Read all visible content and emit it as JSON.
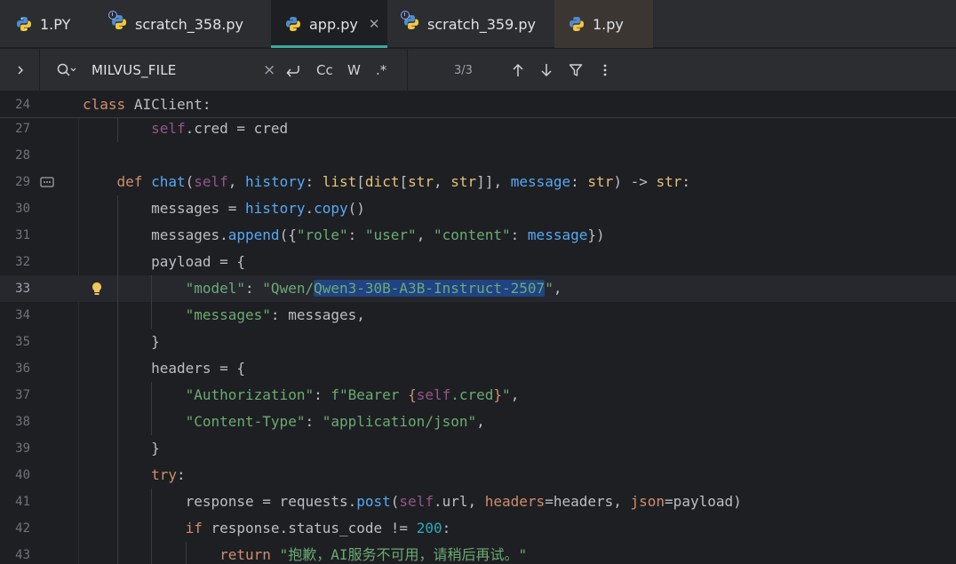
{
  "tabs": [
    {
      "label": "1.PY",
      "active": false,
      "badge": false
    },
    {
      "label": "scratch_358.py",
      "active": false,
      "badge": true
    },
    {
      "label": "app.py",
      "active": true,
      "badge": false
    },
    {
      "label": "scratch_359.py",
      "active": false,
      "badge": true
    },
    {
      "label": "1.py",
      "active": false,
      "badge": false
    }
  ],
  "search": {
    "query": "MILVUS_FILE",
    "clear": "×",
    "case_label": "Cc",
    "word_label": "W",
    "regex_label": ".*",
    "match_count": "3/3"
  },
  "editor": {
    "sticky": {
      "num": "24",
      "text": "class AIClient:"
    },
    "lines": [
      {
        "num": "27",
        "text": "        self.cred = cred"
      },
      {
        "num": "28",
        "text": ""
      },
      {
        "num": "29",
        "text": "    def chat(self, history: list[dict[str, str]], message: str) -> str:"
      },
      {
        "num": "30",
        "text": "        messages = history.copy()"
      },
      {
        "num": "31",
        "text": "        messages.append({\"role\": \"user\", \"content\": message})"
      },
      {
        "num": "32",
        "text": "        payload = {"
      },
      {
        "num": "33",
        "text": "            \"model\": \"Qwen/Qwen3-30B-A3B-Instruct-2507\","
      },
      {
        "num": "34",
        "text": "            \"messages\": messages,"
      },
      {
        "num": "35",
        "text": "        }"
      },
      {
        "num": "36",
        "text": "        headers = {"
      },
      {
        "num": "37",
        "text": "            \"Authorization\": f\"Bearer {self.cred}\","
      },
      {
        "num": "38",
        "text": "            \"Content-Type\": \"application/json\","
      },
      {
        "num": "39",
        "text": "        }"
      },
      {
        "num": "40",
        "text": "        try:"
      },
      {
        "num": "41",
        "text": "            response = requests.post(self.url, headers=headers, json=payload)"
      },
      {
        "num": "42",
        "text": "            if response.status_code != 200:"
      },
      {
        "num": "43",
        "text": "                return \"抱歉，AI服务不可用，请稍后再试。\""
      }
    ],
    "current_line": "33"
  },
  "colors": {
    "keyword": "#cf8e6d",
    "function": "#56a8f5",
    "self": "#94558d",
    "string": "#6aab73",
    "number": "#2aacb8",
    "text": "#bcbec4",
    "active_tab_underline": "#3fa9a0"
  },
  "icons": {
    "tab_icon": "python-icon",
    "badge": "scratch-badge-icon",
    "expand": "chevron-right-icon",
    "search": "search-icon",
    "newline": "multiline-icon",
    "prev": "arrow-up-icon",
    "next": "arrow-down-icon",
    "filter": "filter-icon",
    "more": "more-vertical-icon",
    "gutter": "implements-icon",
    "intention": "lightbulb-icon"
  }
}
